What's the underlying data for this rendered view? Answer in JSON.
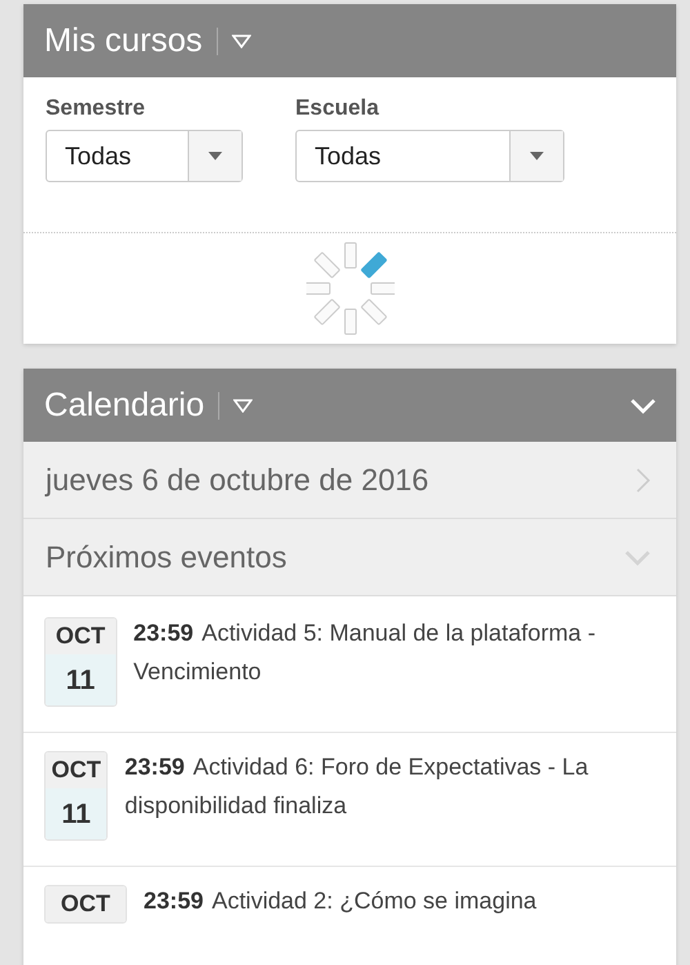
{
  "courses_panel": {
    "title": "Mis cursos",
    "filters": [
      {
        "label": "Semestre",
        "value": "Todas"
      },
      {
        "label": "Escuela",
        "value": "Todas"
      }
    ]
  },
  "calendar_panel": {
    "title": "Calendario",
    "date": "jueves 6 de octubre de 2016",
    "upcoming_title": "Próximos eventos",
    "events": [
      {
        "month": "OCT",
        "day": "11",
        "time": "23:59",
        "title": "Actividad 5: Manual de la plataforma - Vencimiento"
      },
      {
        "month": "OCT",
        "day": "11",
        "time": "23:59",
        "title": "Actividad 6: Foro de Expectativas - La disponibilidad finaliza"
      },
      {
        "month": "OCT",
        "time": "23:59",
        "title": "Actividad 2: ¿Cómo se imagina"
      }
    ]
  }
}
